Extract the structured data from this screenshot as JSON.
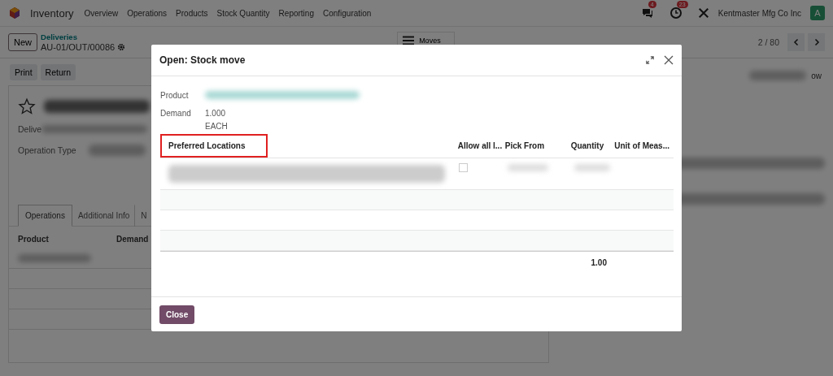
{
  "navbar": {
    "app_name": "Inventory",
    "menu": [
      "Overview",
      "Operations",
      "Products",
      "Stock Quantity",
      "Reporting",
      "Configuration"
    ],
    "messages_badge": "4",
    "activities_badge": "23",
    "company": "Kentmaster Mfg Co Inc",
    "avatar_letter": "A"
  },
  "control_panel": {
    "new_button": "New",
    "breadcrumb_parent": "Deliveries",
    "record_name": "AU-01/OUT/00086",
    "smart_button": "Moves",
    "pager": "2 / 80"
  },
  "action_buttons": [
    "Print",
    "Return"
  ],
  "right_button_fragment": "ow",
  "form": {
    "delivery_label": "Delive",
    "operation_type_label": "Operation Type",
    "tabs": [
      {
        "label": "Operations",
        "selected": true
      },
      {
        "label": "Additional Info",
        "selected": false
      },
      {
        "label": "N",
        "selected": false
      }
    ],
    "columns": [
      "Product",
      "Demand"
    ]
  },
  "dialog": {
    "title": "Open: Stock move",
    "product_label": "Product",
    "demand_label": "Demand",
    "demand_value": "1.000",
    "demand_unit": "EACH",
    "columns": [
      {
        "label": "Preferred Locations",
        "highlighted": true
      },
      {
        "label": "Allow all l...",
        "highlighted": false
      },
      {
        "label": "Pick From",
        "highlighted": false
      },
      {
        "label": "Quantity",
        "highlighted": false
      },
      {
        "label": "Unit of Meas...",
        "highlighted": false
      }
    ],
    "rows": [
      {
        "kind": "data",
        "allow_all": false
      },
      {
        "kind": "empty"
      },
      {
        "kind": "empty"
      },
      {
        "kind": "empty"
      }
    ],
    "total_quantity": "1.00",
    "buttons": [
      "Close"
    ]
  }
}
